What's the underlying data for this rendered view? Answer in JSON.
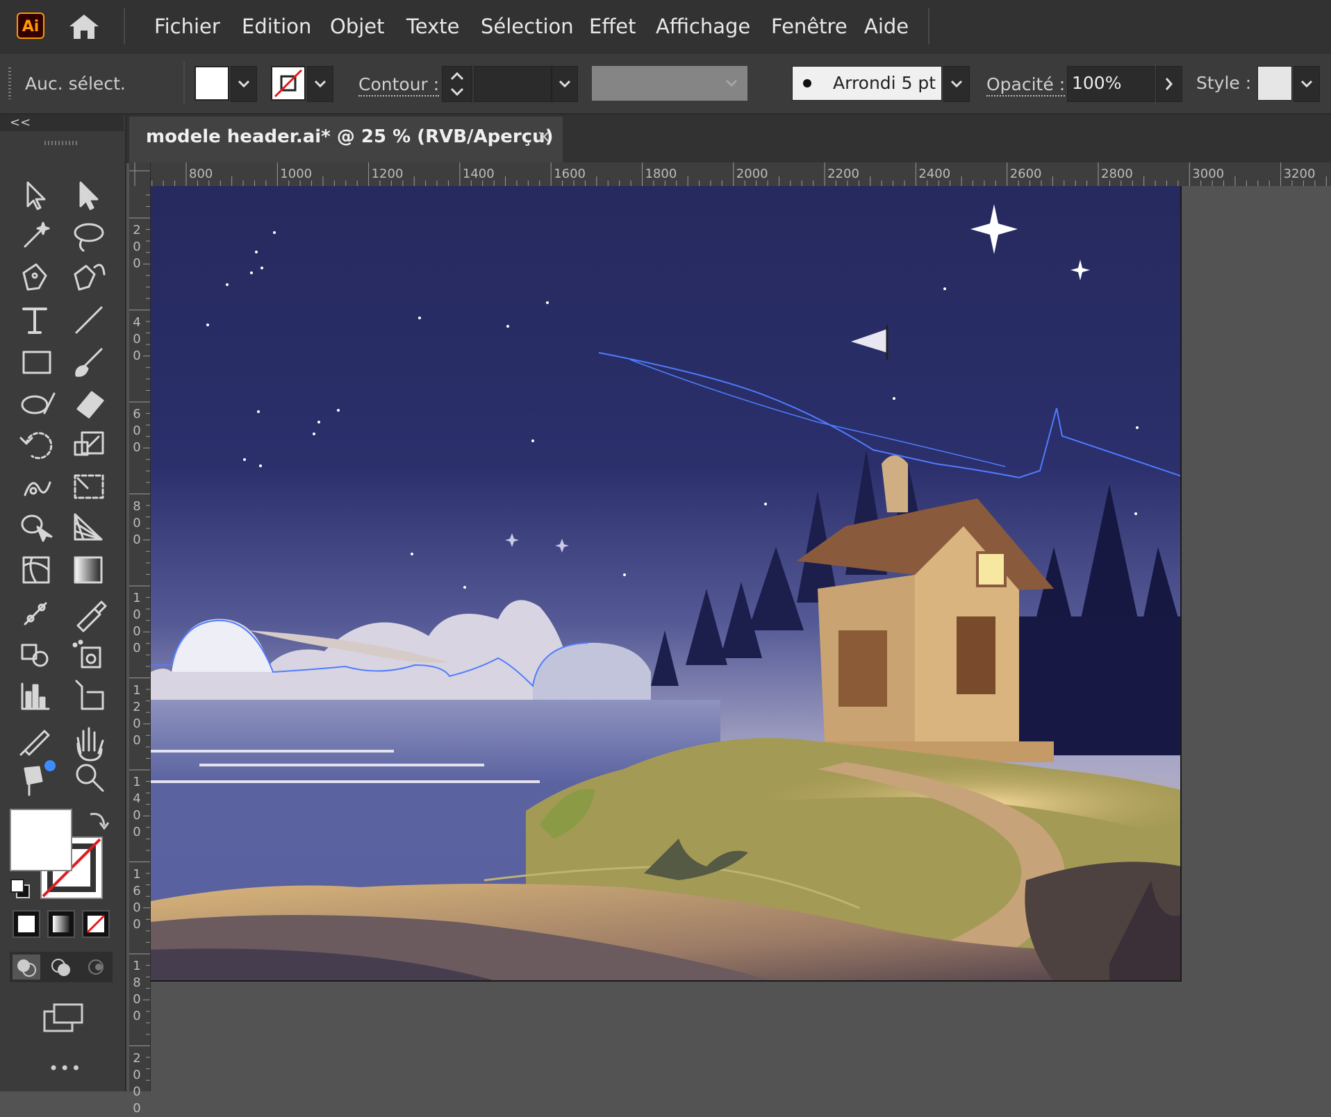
{
  "app": {
    "logo": "Ai",
    "accent": "#ff9a00"
  },
  "menubar": {
    "items": [
      "Fichier",
      "Edition",
      "Objet",
      "Texte",
      "Sélection",
      "Effet",
      "Affichage",
      "Fenêtre",
      "Aide"
    ]
  },
  "controlbar": {
    "selection_status": "Auc. sélect.",
    "fill_color": "#ffffff",
    "stroke": "none",
    "contour_label": "Contour :",
    "contour_value": "",
    "brush_label": "Arrondi 5 pt",
    "opacity_label": "Opacité :",
    "opacity_value": "100%",
    "style_label": "Style :"
  },
  "toolbox": {
    "collapse_label": "<<",
    "more_label": "•••",
    "tools": [
      "selection-tool",
      "direct-selection-tool",
      "magic-wand-tool",
      "lasso-tool",
      "pen-tool",
      "curvature-tool",
      "type-tool",
      "line-segment-tool",
      "rectangle-tool",
      "paintbrush-tool",
      "shaper-tool",
      "eraser-tool",
      "rotate-tool",
      "scale-tool",
      "warp-tool",
      "free-transform-tool",
      "shape-builder-tool",
      "perspective-grid-tool",
      "mesh-tool",
      "gradient-tool",
      "eyedropper-measure-tool",
      "eyedropper-tool",
      "blend-tool",
      "symbol-sprayer-tool",
      "column-graph-tool",
      "artboard-tool",
      "slice-tool",
      "hand-tool",
      "puppet-warp-tool",
      "zoom-tool"
    ]
  },
  "document": {
    "tab_title": "modele header.ai* @ 25 % (RVB/Aperçu)",
    "close_label": "×",
    "zoom": "25 %",
    "color_mode": "RVB",
    "view_mode": "Aperçu"
  },
  "rulers": {
    "top": [
      "800",
      "1000",
      "1200",
      "1400",
      "1600",
      "1800",
      "2000",
      "2200",
      "2400",
      "2600",
      "2800",
      "3000",
      "3200"
    ],
    "left": [
      "200",
      "400",
      "600",
      "800",
      "1000",
      "1200",
      "1400",
      "1600",
      "1800",
      "2000"
    ]
  },
  "colors": {
    "sky_top": "#262a5e",
    "sky_bottom": "#9a9ac4",
    "sea": "#5a62a0",
    "hill": "#a39a55",
    "ground": "#d7b47a",
    "house": "#d9b47e",
    "roof": "#8a5a3c",
    "trees": "#1c1e4c",
    "selection": "#4f7dff"
  }
}
